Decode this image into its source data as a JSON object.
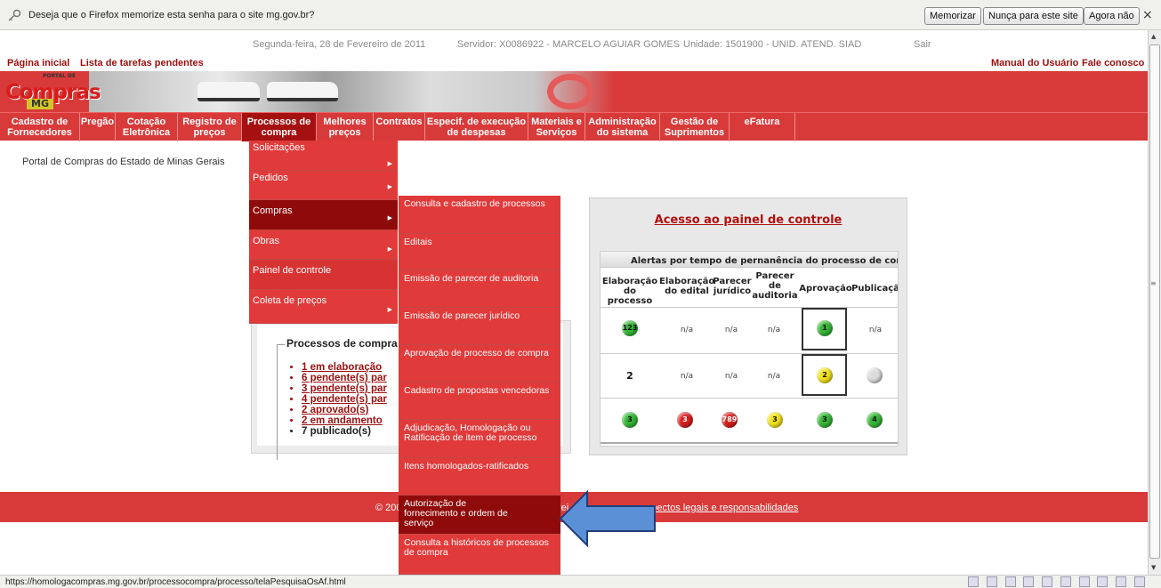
{
  "firefox_bar": {
    "message": "Deseja que o Firefox memorize esta senha para o site mg.gov.br?",
    "btn_remember": "Memorizar",
    "btn_never": "Nunça para este site",
    "btn_not_now": "Agora não",
    "close": "×"
  },
  "info": {
    "date": "Segunda-feira, 28 de Fevereiro de 2011",
    "server": "Servidor: X0086922 - MARCELO AGUIAR GOMES",
    "unit": "Unidade: 1501900 - UNID. ATEND. SIAD",
    "exit": "Sair"
  },
  "top_links": {
    "home": "Página inicial",
    "tasks": "Lista de tarefas pendentes",
    "manual": "Manual do Usuário",
    "contact": "Fale conosco"
  },
  "logo": {
    "main": "Compras",
    "small": "PORTAL DE",
    "state": "MG"
  },
  "nav": [
    {
      "label1": "Cadastro de",
      "label2": "Fornecedores"
    },
    {
      "label1": "Pregão",
      "label2": ""
    },
    {
      "label1": "Cotação",
      "label2": "Eletrônica"
    },
    {
      "label1": "Registro de",
      "label2": "preços"
    },
    {
      "label1": "Processos de",
      "label2": "compra"
    },
    {
      "label1": "Melhores",
      "label2": "preços"
    },
    {
      "label1": "Contratos",
      "label2": ""
    },
    {
      "label1": "Especif. de execução",
      "label2": "de despesas"
    },
    {
      "label1": "Materiais e",
      "label2": "Serviços"
    },
    {
      "label1": "Administração",
      "label2": "do sistema"
    },
    {
      "label1": "Gestão de",
      "label2": "Suprimentos"
    },
    {
      "label1": "eFatura",
      "label2": ""
    }
  ],
  "portal_text": "Portal de Compras do Estado de Minas Gerais",
  "menu_level1": [
    {
      "label": "Solicitações"
    },
    {
      "label": "Pedidos"
    },
    {
      "label": "Compras"
    },
    {
      "label": "Obras"
    },
    {
      "label": "Painel de controle"
    },
    {
      "label": "Coleta de preços"
    }
  ],
  "menu_level2": [
    {
      "label": "Consulta e cadastro de processos"
    },
    {
      "label": "Editais"
    },
    {
      "label": "Emissão de parecer de auditoria"
    },
    {
      "label": "Emissão de parecer jurídico"
    },
    {
      "label": "Aprovação de processo de compra"
    },
    {
      "label": "Cadastro de propostas vencedoras"
    },
    {
      "label": "Adjudicação, Homologação ou Ratificação de item de processo"
    },
    {
      "label": "Itens homologados-ratificados"
    },
    {
      "label": "Autorização de fornecimento e ordem de serviço"
    },
    {
      "label": "Consulta a históricos de processos de compra"
    }
  ],
  "processes": {
    "legend": "Processos de compra",
    "items": [
      "1 em elaboração",
      "6 pendente(s) par",
      "3 pendente(s) par",
      "4 pendente(s) par",
      "2 aprovado(s)",
      "2 em andamento",
      "7 publicado(s)"
    ]
  },
  "control_panel": {
    "title": "Acesso ao painel de controle",
    "table_header": "Alertas por tempo de pernanência do processo de compra em",
    "columns": [
      {
        "l1": "Elaboração",
        "l2": "do processo",
        "l3": ""
      },
      {
        "l1": "Elaboração",
        "l2": "do edital",
        "l3": ""
      },
      {
        "l1": "Parecer",
        "l2": "jurídico",
        "l3": ""
      },
      {
        "l1": "Parecer",
        "l2": "de",
        "l3": "auditoria"
      },
      {
        "l1": "Aprovação",
        "l2": "",
        "l3": ""
      },
      {
        "l1": "Publicaçã",
        "l2": "",
        "l3": ""
      }
    ],
    "rows": [
      [
        "123",
        "n/a",
        "n/a",
        "n/a",
        "1",
        "n/a"
      ],
      [
        "2",
        "n/a",
        "n/a",
        "n/a",
        "2",
        ""
      ],
      [
        "3",
        "3",
        "789",
        "3",
        "3",
        "4"
      ]
    ]
  },
  "footer": {
    "copyright": "© 200",
    "rights_tail": "rei",
    "legal_link": "pectos legais e responsabilidades"
  },
  "status": {
    "url": "https://homologacompras.mg.gov.br/processocompra/processo/telaPesquisaOsAf.html"
  },
  "colors": {
    "brand_red": "#d83a3a",
    "active_red": "#8f0b0b",
    "link_red": "#9b0f0f",
    "arrow_blue": "#5b8fd6"
  }
}
